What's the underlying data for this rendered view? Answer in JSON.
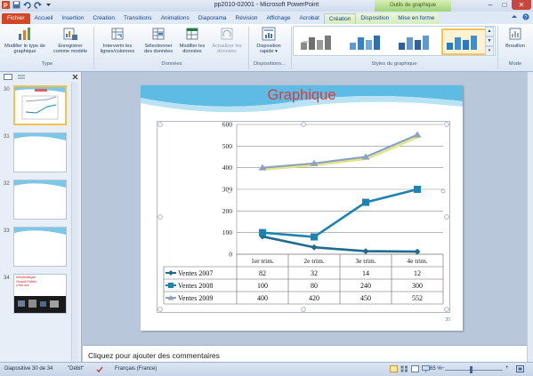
{
  "window": {
    "title": "pp2010-02001 - Microsoft PowerPoint",
    "contextual_group": "Outils de graphique",
    "minimize": "–",
    "maximize": "□",
    "close": "✕"
  },
  "tabs": [
    "Fichier",
    "Accueil",
    "Insertion",
    "Création",
    "Transitions",
    "Animations",
    "Diaporama",
    "Révision",
    "Affichage",
    "Acrobat",
    "Création",
    "Disposition",
    "Mise en forme"
  ],
  "ribbon": {
    "change_type": "Modifier le type de graphique",
    "save_template": "Enregistrer comme modèle",
    "group_type": "Type",
    "switch_rowcol": "Intervertir les lignes/colonnes",
    "select_data": "Sélectionner des données",
    "edit_data": "Modifier les données",
    "refresh_data": "Actualiser les données",
    "group_data": "Données",
    "quick_layout": "Disposition rapide ▾",
    "group_layouts": "Dispositions...",
    "group_styles": "Styles du graphique",
    "draft": "Brouillon",
    "group_mode": "Mode"
  },
  "slides_pane": {
    "slide_numbers": [
      "30",
      "31",
      "32",
      "33",
      "34"
    ],
    "thumb34_lines": [
      "Informatique",
      "Grand Public",
      "c'est sur"
    ]
  },
  "slide": {
    "title": "Graphique",
    "number": "30"
  },
  "chart_data": {
    "type": "line",
    "categories": [
      "1er trim.",
      "2e trim.",
      "3e trim.",
      "4e trim."
    ],
    "series": [
      {
        "name": "Ventes 2007",
        "values": [
          82,
          32,
          14,
          12
        ]
      },
      {
        "name": "Ventes 2008",
        "values": [
          100,
          80,
          240,
          300
        ]
      },
      {
        "name": "Ventes 2009",
        "values": [
          400,
          420,
          450,
          552
        ]
      }
    ],
    "ylim": [
      0,
      600
    ],
    "yticks": [
      "0",
      "100",
      "200",
      "300",
      "400",
      "500",
      "600"
    ],
    "grid": true,
    "legend": "data table"
  },
  "colors": {
    "series_2007": "#1f6a8f",
    "series_2008": "#1d82b4",
    "series_2009": "#8aa4c0",
    "title_red": "#d83b3b",
    "accent_file": "#d24726"
  },
  "notes": {
    "placeholder": "Cliquez pour ajouter des commentaires"
  },
  "status": {
    "slide_of": "Diapositive 30 de 34",
    "theme": "\"Débit\"",
    "language": "Français (France)",
    "zoom": "65 %"
  }
}
